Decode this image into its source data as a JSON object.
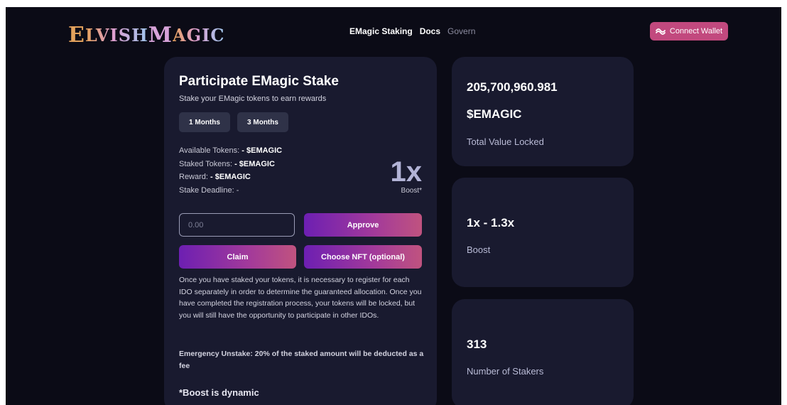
{
  "header": {
    "logo": {
      "first": "E",
      "mid": "LVISH ",
      "m": "M",
      "rest": "AGIC"
    },
    "nav": [
      "EMagic Staking",
      "Docs",
      "Govern"
    ],
    "connect_label": "Connect Wallet"
  },
  "stake": {
    "title": "Participate EMagic Stake",
    "subtitle": "Stake your EMagic tokens to earn rewards",
    "periods": [
      "1 Months",
      "3 Months"
    ],
    "available_label": "Available Tokens:",
    "available_value": "- $EMAGIC",
    "staked_label": "Staked Tokens:",
    "staked_value": "- $EMAGIC",
    "reward_label": "Reward:",
    "reward_value": "- $EMAGIC",
    "deadline_label": "Stake Deadline:",
    "deadline_value": "-",
    "boost_value": "1x",
    "boost_label": "Boost*",
    "amount_placeholder": "0.00",
    "approve_label": "Approve",
    "claim_label": "Claim",
    "nft_label": "Choose NFT (optional)",
    "info_text": "Once you have staked your tokens, it is necessary to register for each IDO separately in order to determine the guaranteed allocation. Once you have completed the registration process, your tokens will be locked, but you will still have the opportunity to participate in other IDOs.",
    "emergency_text": "Emergency Unstake: 20% of the staked amount will be deducted as a fee",
    "dynamic_note": "*Boost is dynamic"
  },
  "stats": {
    "tvl_value": "205,700,960.981",
    "tvl_unit": "$EMAGIC",
    "tvl_label": "Total Value Locked",
    "boost_range": "1x - 1.3x",
    "boost_label": "Boost",
    "stakers_value": "313",
    "stakers_label": "Number of Stakers"
  },
  "colors": {
    "background": "#0b0b16",
    "card": "#191a2f",
    "accent": "#c2497e",
    "button": "#2f3248",
    "gradient_start": "#6d1fb2",
    "gradient_end": "#c0537f"
  },
  "icons": {
    "connect": "wallet-wave-icon"
  }
}
